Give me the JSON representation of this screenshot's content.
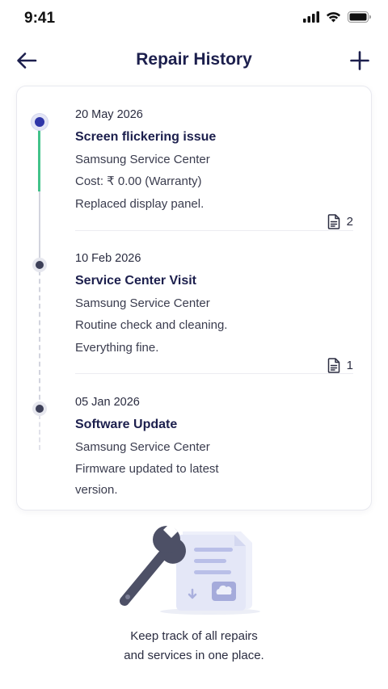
{
  "status_bar": {
    "time": "9:41"
  },
  "header": {
    "title": "Repair History",
    "back_icon": "arrow-left-icon",
    "add_icon": "plus-icon"
  },
  "colors": {
    "primary": "#1c1f4d",
    "accent_blue": "#2f36a8",
    "accent_green": "#43c38a"
  },
  "entries": [
    {
      "date": "20 May 2026",
      "title": "Screen flickering issue",
      "center": "Samsung Service Center",
      "line_a": "Cost: ₹ 0.00 (Warranty)",
      "line_b": "Replaced display panel.",
      "attachments": "2",
      "status": "active"
    },
    {
      "date": "10 Feb 2026",
      "title": "Service Center Visit",
      "center": "Samsung Service Center",
      "line_a": "Routine check and cleaning.",
      "line_b": "Everything fine.",
      "attachments": "1",
      "status": "past"
    },
    {
      "date": "05 Jan 2026",
      "title": "Software Update",
      "center": "Samsung Service Center",
      "line_a": "Firmware updated to latest",
      "line_b": "version.",
      "status": "past"
    }
  ],
  "footer": {
    "line1": "Keep track of all repairs",
    "line2": "and services in one place."
  }
}
